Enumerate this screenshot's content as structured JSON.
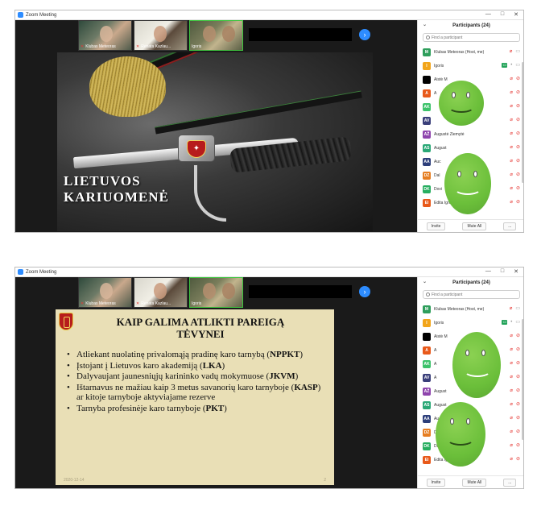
{
  "screens": [
    {
      "window_title": "Zoom Meeting",
      "window_controls": [
        "—",
        "□",
        "✕"
      ],
      "thumbnails": [
        {
          "name": "Klubas Meteoras"
        },
        {
          "name": "Renata Kazlau..."
        },
        {
          "name": "Igoris"
        }
      ],
      "slide_title_line1": "LIETUVOS",
      "slide_title_line2": "KARIUOMENĖ",
      "panel_title": "Participants (24)",
      "search_placeholder": "Find a participant",
      "participants": [
        {
          "initials": "M",
          "color": "#2e9e5b",
          "name": "Klubas Meteoras (Host, me)"
        },
        {
          "initials": "I",
          "color": "#f2a51a",
          "name": "Igoris"
        },
        {
          "initials": "",
          "color": "#000000",
          "name": "Aistė M"
        },
        {
          "initials": "A",
          "color": "#e8591a",
          "name": "A"
        },
        {
          "initials": "AK",
          "color": "#3cc26a",
          "name": ""
        },
        {
          "initials": "AV",
          "color": "#3a3f7a",
          "name": ""
        },
        {
          "initials": "AŽ",
          "color": "#8e44ad",
          "name": "Augustė Žiemytė"
        },
        {
          "initials": "AS",
          "color": "#2aa876",
          "name": "August"
        },
        {
          "initials": "AA",
          "color": "#2c3e7a",
          "name": "Auc"
        },
        {
          "initials": "DZ",
          "color": "#e67e22",
          "name": "Dal"
        },
        {
          "initials": "DK",
          "color": "#27ae60",
          "name": "Dovi"
        },
        {
          "initials": "EI",
          "color": "#e8591a",
          "name": "Edita Ignatav..."
        }
      ],
      "buttons": {
        "invite": "Invite",
        "mute_all": "Mute All",
        "more": "..."
      }
    },
    {
      "window_title": "Zoom Meeting",
      "window_controls": [
        "—",
        "□",
        "✕"
      ],
      "thumbnails": [
        {
          "name": "Klubas Meteoras"
        },
        {
          "name": "Renata Kazlau..."
        },
        {
          "name": "Igoris"
        }
      ],
      "slide_heading_line1": "KAIP GALIMA ATLIKTI PAREIGĄ",
      "slide_heading_line2": "TĖVYNEI",
      "bullets": [
        {
          "text": "Atliekant nuolatinę privalomąją pradinę karo tarnybą (",
          "bold": "NPPKT",
          "after": ")"
        },
        {
          "text": "Įstojant į Lietuvos karo akademiją (",
          "bold": "LKA",
          "after": ")"
        },
        {
          "text": "Dalyvaujant jaunesniųjų karininko vadų mokymuose (",
          "bold": "JKVM",
          "after": ")"
        },
        {
          "text": "Ištarnavus ne mažiau kaip 3 metus savanorių karo tarnyboje (",
          "bold": "KASP",
          "after": ") ar kitoje tarnyboje aktyviajame rezerve"
        },
        {
          "text": "Tarnyba profesinėje karo tarnyboje (",
          "bold": "PKT",
          "after": ")"
        }
      ],
      "slide_footer": "2020-12-14",
      "slide_page": "2",
      "panel_title": "Participants (24)",
      "search_placeholder": "Find a participant",
      "participants": [
        {
          "initials": "M",
          "color": "#2e9e5b",
          "name": "Klubas Meteoras (Host, me)"
        },
        {
          "initials": "I",
          "color": "#f2a51a",
          "name": "Igoris"
        },
        {
          "initials": "",
          "color": "#000000",
          "name": "Aistė M"
        },
        {
          "initials": "A",
          "color": "#e8591a",
          "name": "A"
        },
        {
          "initials": "AK",
          "color": "#3cc26a",
          "name": "A"
        },
        {
          "initials": "AV",
          "color": "#3a3f7a",
          "name": "A"
        },
        {
          "initials": "AŽ",
          "color": "#8e44ad",
          "name": "August"
        },
        {
          "initials": "AS",
          "color": "#2aa876",
          "name": "August"
        },
        {
          "initials": "AA",
          "color": "#2c3e7a",
          "name": "Au"
        },
        {
          "initials": "DZ",
          "color": "#e67e22",
          "name": "D"
        },
        {
          "initials": "DK",
          "color": "#27ae60",
          "name": "Do"
        },
        {
          "initials": "EI",
          "color": "#e8591a",
          "name": "Edita Ig"
        }
      ],
      "buttons": {
        "invite": "Invite",
        "mute_all": "Mute All",
        "more": "..."
      }
    }
  ],
  "icons": {
    "mic_off": "mic-off-icon",
    "video_off": "video-off-icon",
    "video_on": "video-on-icon",
    "screen_share": "screen-share-icon",
    "next_page": "chevron-right-icon"
  },
  "colors": {
    "accent": "#2d8cff",
    "mic_off": "#e53935",
    "slide_background": "#e9dfb6",
    "smiley": "#6bbf3a"
  }
}
